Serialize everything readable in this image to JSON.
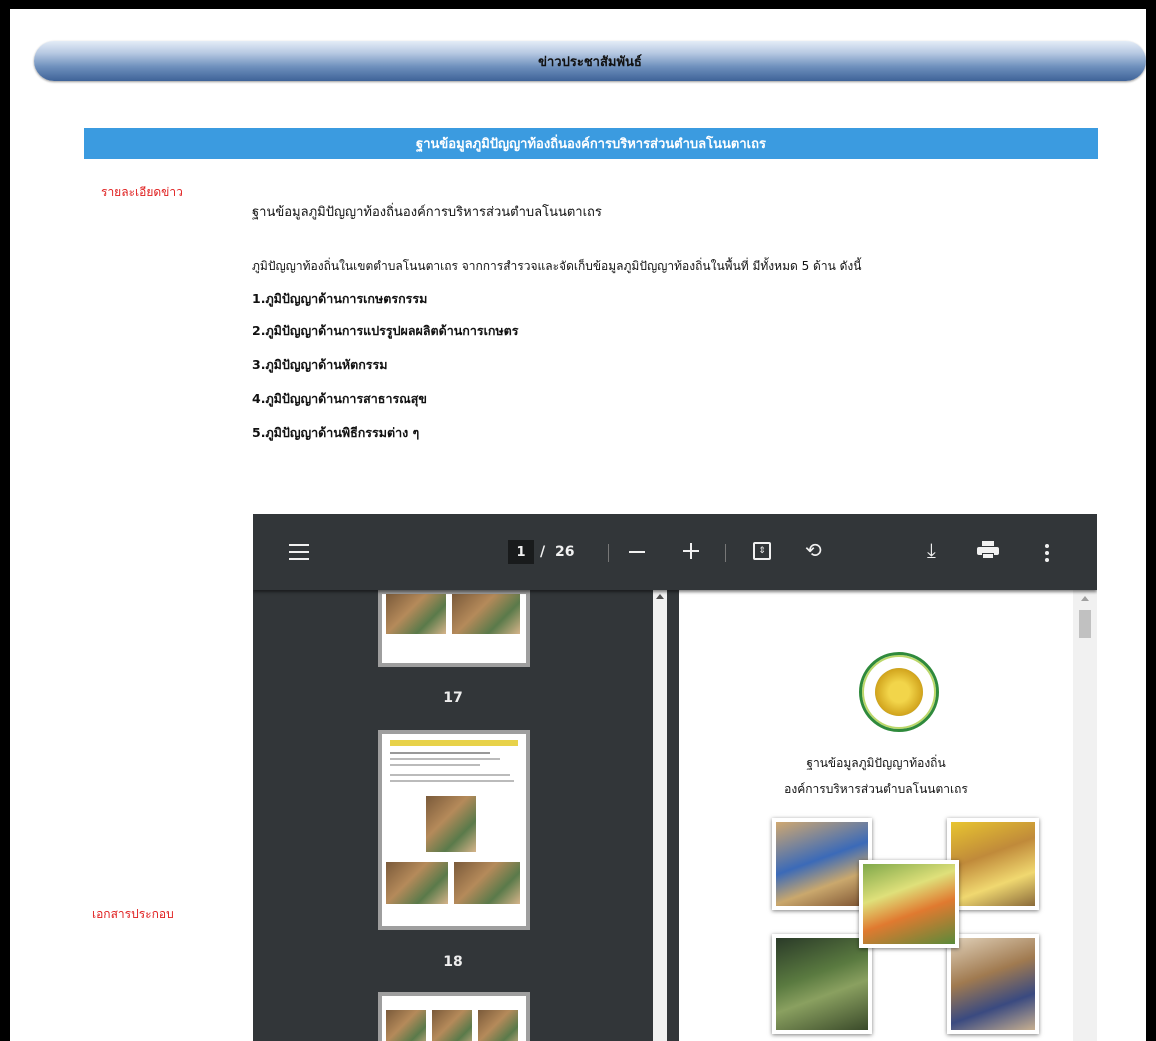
{
  "header": {
    "title": "ข่าวประชาสัมพันธ์"
  },
  "news": {
    "title": "ฐานข้อมูลภูมิปัญญาท้องถิ่นองค์การบริหารส่วนตำบลโนนตาเถร",
    "detail_label": "รายละเอียดข่าว",
    "attachment_label": "เอกสารประกอบ",
    "doc_title": "ฐานข้อมูลภูมิปัญญาท้องถิ่นองค์การบริหารส่วนตำบลโนนตาเถร",
    "intro": "ภูมิปัญญาท้องถิ่นในเขตตำบลโนนตาเถร จากการสำรวจและจัดเก็บข้อมูลภูมิปัญญาท้องถิ่นในพื้นที่  มีทั้งหมด 5 ด้าน ดังนี้",
    "items": [
      "1.ภูมิปัญญาด้านการเกษตรกรรม",
      "2.ภูมิปัญญาด้านการแปรรูปผลผลิตด้านการเกษตร",
      "3.ภูมิปัญญาด้านหัตกรรม",
      "4.ภูมิปัญญาด้านการสาธารณสุข",
      "5.ภูมิปัญญาด้านพิธีกรรมต่าง ๆ"
    ]
  },
  "pdf": {
    "current_page": "1",
    "separator": "/",
    "total_pages": "26",
    "thumbnails": [
      {
        "label": "17"
      },
      {
        "label": "18"
      }
    ],
    "cover": {
      "line1": "ฐานข้อมูลภูมิปัญญาท้องถิ่น",
      "line2": "องค์การบริหารส่วนตำบลโนนตาเถร"
    },
    "icons": {
      "fit": "⇕",
      "rotate": "⟲",
      "download": "⤓"
    }
  }
}
